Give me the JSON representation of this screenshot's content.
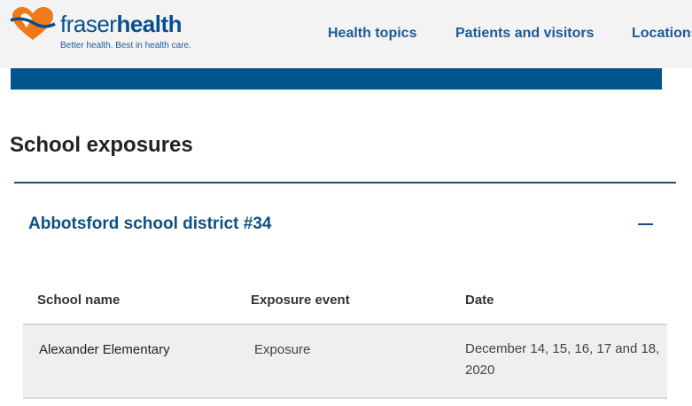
{
  "header": {
    "logo_first": "fraser",
    "logo_second": "health",
    "tagline": "Better health. Best in health care.",
    "nav": [
      {
        "label": "Health topics"
      },
      {
        "label": "Patients and visitors"
      },
      {
        "label": "Locations"
      }
    ]
  },
  "page": {
    "title": "School exposures"
  },
  "accordion": {
    "title": "Abbotsford school district #34",
    "toggle_icon": "minus-icon",
    "columns": [
      "School name",
      "Exposure event",
      "Date"
    ],
    "rows": [
      {
        "school": "Alexander Elementary",
        "event": "Exposure",
        "date": "December 14, 15, 16, 17 and 18, 2020"
      }
    ]
  },
  "colors": {
    "brand_blue": "#00558d",
    "link_blue": "#1c5a9a",
    "logo_orange": "#f07a1a",
    "header_bg": "#f3f3f3"
  }
}
